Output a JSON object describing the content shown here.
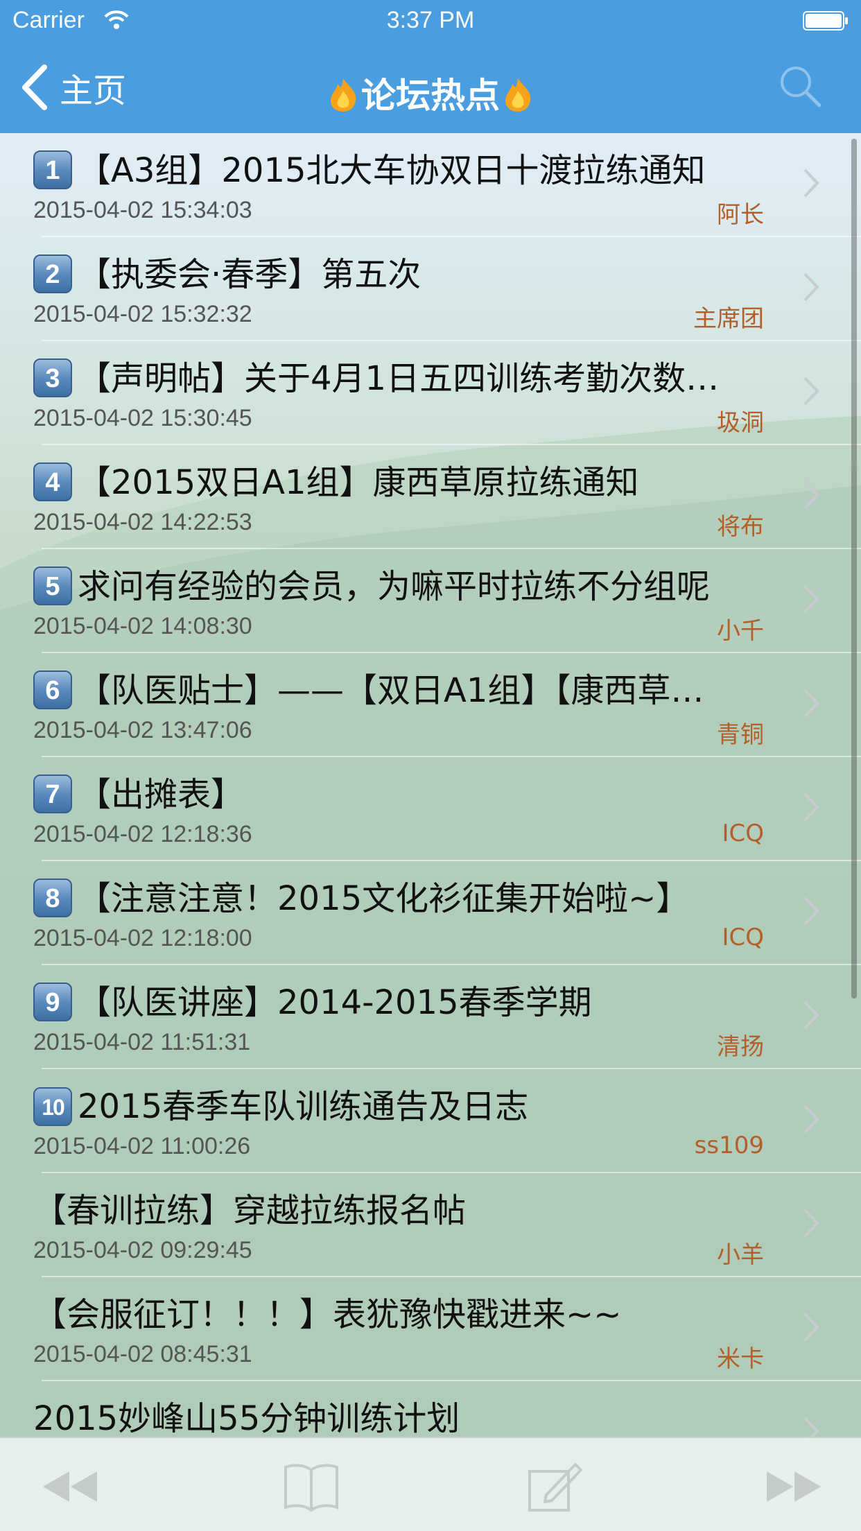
{
  "status_bar": {
    "carrier": "Carrier",
    "time": "3:37 PM"
  },
  "nav": {
    "back_label": "主页",
    "title": "论坛热点",
    "search_icon": "search-icon"
  },
  "colors": {
    "bar_blue": "#4a9ddf",
    "author": "#b45f2a",
    "date": "#555555"
  },
  "list": {
    "items": [
      {
        "rank": "1",
        "title": "【A3组】2015北大车协双日十渡拉练通知",
        "date": "2015-04-02 15:34:03",
        "author": "阿长"
      },
      {
        "rank": "2",
        "title": "【执委会·春季】第五次",
        "date": "2015-04-02 15:32:32",
        "author": "主席团"
      },
      {
        "rank": "3",
        "title": "【声明帖】关于4月1日五四训练考勤次数…",
        "date": "2015-04-02 15:30:45",
        "author": "圾洞"
      },
      {
        "rank": "4",
        "title": "【2015双日A1组】康西草原拉练通知",
        "date": "2015-04-02 14:22:53",
        "author": "将布"
      },
      {
        "rank": "5",
        "title": "求问有经验的会员，为嘛平时拉练不分组呢",
        "date": "2015-04-02 14:08:30",
        "author": "小千"
      },
      {
        "rank": "6",
        "title": "【队医贴士】——【双日A1组】【康西草…",
        "date": "2015-04-02 13:47:06",
        "author": "青铜"
      },
      {
        "rank": "7",
        "title": "【出摊表】",
        "date": "2015-04-02 12:18:36",
        "author": "ICQ"
      },
      {
        "rank": "8",
        "title": "【注意注意！2015文化衫征集开始啦~】",
        "date": "2015-04-02 12:18:00",
        "author": "ICQ"
      },
      {
        "rank": "9",
        "title": "【队医讲座】2014-2015春季学期",
        "date": "2015-04-02 11:51:31",
        "author": "清扬"
      },
      {
        "rank": "10",
        "title": "2015春季车队训练通告及日志",
        "date": "2015-04-02 11:00:26",
        "author": "ss109"
      },
      {
        "rank": "",
        "title": "【春训拉练】穿越拉练报名帖",
        "date": "2015-04-02 09:29:45",
        "author": "小羊"
      },
      {
        "rank": "",
        "title": "【会服征订！！！】表犹豫快戳进来~~",
        "date": "2015-04-02 08:45:31",
        "author": "米卡"
      },
      {
        "rank": "",
        "title": "2015妙峰山55分钟训练计划",
        "date": "",
        "author": ""
      }
    ]
  },
  "toolbar": {
    "first_icon": "rewind-icon",
    "book_icon": "book-icon",
    "compose_icon": "compose-icon",
    "last_icon": "fast-forward-icon"
  }
}
